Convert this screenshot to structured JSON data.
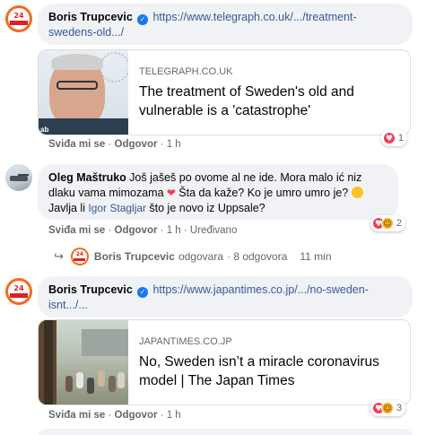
{
  "comments": [
    {
      "author": "Boris Trupcevic",
      "verified_mark": "✓",
      "link": "https://www.telegraph.co.uk/.../treatment-swedens-old.../",
      "avatar_icon": "news-page-logo",
      "card": {
        "domain": "TELEGRAPH.CO.UK",
        "headline": "The treatment of Sweden's old and vulnerable is a 'catastrophe'",
        "thumb_tag": "ab"
      },
      "actions": {
        "like": "Sviđa mi se",
        "reply": "Odgovor",
        "time": "1 h"
      },
      "reactions": {
        "icons": [
          "love"
        ],
        "count": "1"
      }
    },
    {
      "author": "Oleg Maštruko",
      "text_part1": "Još jašeš po ovome al ne ide. Mora malo ić niz dlaku vama mimozama",
      "heart_glyph": "❤",
      "text_part2": "Šta da kaže? Ko je umro umro je?",
      "text_part3": "Javlja li",
      "mention": "Igor Stagljar",
      "text_part4": "što je novo iz Uppsale?",
      "avatar_icon": "tank-photo",
      "actions": {
        "like": "Sviđa mi se",
        "reply": "Odgovor",
        "time": "1 h",
        "edited": "Uređivano"
      },
      "reactions": {
        "icons": [
          "love",
          "haha"
        ],
        "count": "2"
      }
    },
    {
      "author": "Boris Trupcevic",
      "verified_mark": "✓",
      "link": "https://www.japantimes.co.jp/.../no-sweden-isnt.../...",
      "avatar_icon": "news-page-logo",
      "card": {
        "domain": "JAPANTIMES.CO.JP",
        "headline": "No, Sweden isn’t a miracle coronavirus model | The Japan Times"
      },
      "actions": {
        "like": "Sviđa mi se",
        "reply": "Odgovor",
        "time": "1 h"
      },
      "reactions": {
        "icons": [
          "love",
          "haha"
        ],
        "count": "3"
      }
    }
  ],
  "reply_summary": {
    "arrow_icon": "reply-arrow-icon",
    "author": "Boris Trupcevic",
    "verb": "odgovara",
    "count": "· 8 odgovora",
    "time": "11 min"
  },
  "avatar_text": {
    "num": "24"
  },
  "colors": {
    "link": "#385898",
    "bubble": "#f0f2f5",
    "love": "#f33e58",
    "haha": "#f7b125",
    "verified": "#1877f2"
  }
}
